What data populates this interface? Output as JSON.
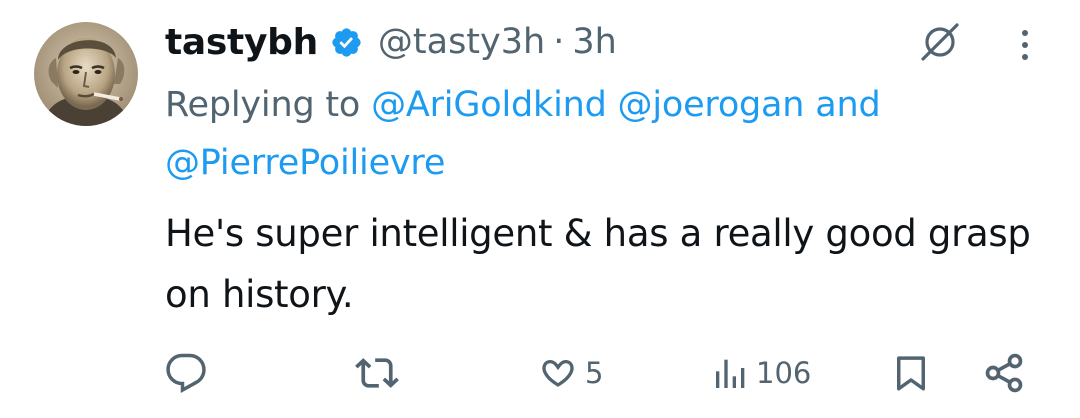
{
  "tweet": {
    "display_name": "tastybh",
    "handle": "@tasty3h",
    "separator": "·",
    "time": "3h",
    "reply_prefix": "Replying to",
    "mention_1": "@AriGoldkind",
    "mention_2": "@joerogan",
    "mention_join": "and",
    "mention_3": "@PierrePoilievre",
    "text": "He's super intelligent & has a really good grasp on history."
  },
  "actions": {
    "likes": "5",
    "views": "106"
  },
  "colors": {
    "verified": "#1d9bf0",
    "link": "#1d9bf0",
    "secondary_text": "#536471",
    "icon": "#536471"
  },
  "icons": {
    "verified": "verified-badge-icon",
    "grok": "grok-icon",
    "more": "more-dots-icon",
    "reply": "reply-icon",
    "retweet": "retweet-icon",
    "like": "heart-icon",
    "views": "views-icon",
    "bookmark": "bookmark-icon",
    "share": "share-icon"
  }
}
